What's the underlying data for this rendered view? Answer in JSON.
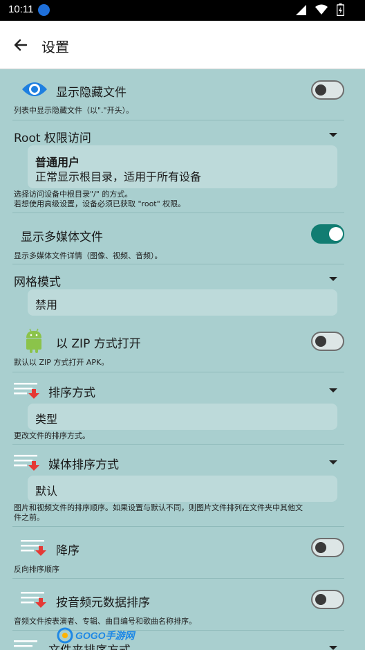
{
  "status_bar": {
    "time": "10:11"
  },
  "app_bar": {
    "title": "设置"
  },
  "settings": {
    "show_hidden": {
      "label": "显示隐藏文件",
      "desc": "列表中显示隐藏文件（以\".\"开头）。",
      "on": false
    },
    "root": {
      "label": "Root 权限访问",
      "selected_title": "普通用户",
      "selected_desc": "正常显示根目录，适用于所有设备",
      "desc_1": "选择访问设备中根目录\"/\" 的方式。",
      "desc_2": "若想使用高级设置，设备必须已获取 \"root\" 权限。"
    },
    "media": {
      "label": "显示多媒体文件",
      "desc": "显示多媒体文件详情（图像、视频、音频）。",
      "on": true
    },
    "grid": {
      "label": "网格模式",
      "value": "禁用"
    },
    "zip": {
      "label": "以 ZIP 方式打开",
      "desc": "默认以 ZIP 方式打开 APK。",
      "on": false
    },
    "sort": {
      "label": "排序方式",
      "value": "类型",
      "desc": "更改文件的排序方式。"
    },
    "media_sort": {
      "label": "媒体排序方式",
      "value": "默认",
      "desc_1": "图片和视频文件的排序顺序。如果设置与默认不同，则图片文件排列在文件夹中其他文",
      "desc_2": "件之前。"
    },
    "descending": {
      "label": "降序",
      "desc": "反向排序顺序",
      "on": false
    },
    "audio_meta": {
      "label": "按音频元数据排序",
      "desc": "音频文件按表演者、专辑、曲目编号和歌曲名称排序。",
      "on": false
    },
    "folder_sort": {
      "label": "文件夹排序方式"
    }
  },
  "watermark": {
    "text": "GOGO手游网"
  },
  "colors": {
    "accent": "#117d72",
    "background": "#a9cfcf",
    "option_box": "#bddada",
    "eye_icon": "#1e7fe0",
    "android_icon": "#8bc34a",
    "sort_arrow": "#e53935"
  }
}
